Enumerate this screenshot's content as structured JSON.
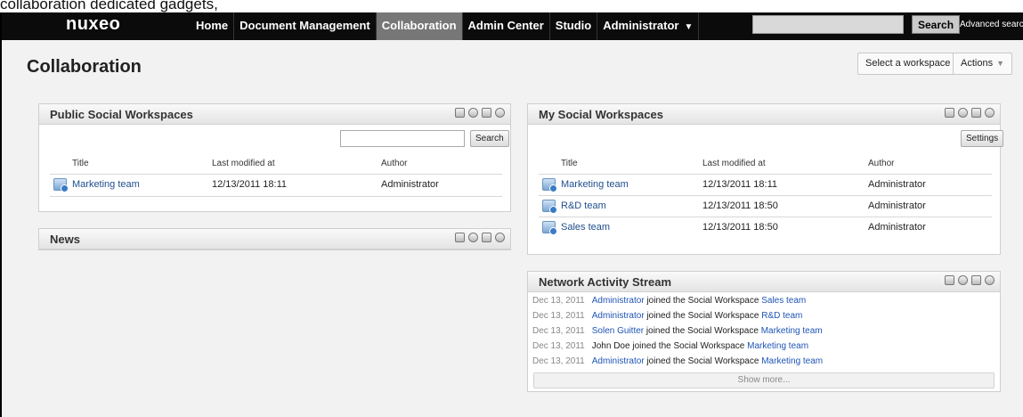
{
  "caption": "collaboration dedicated gadgets,",
  "topbar": {
    "logo": "nuxeo",
    "nav": [
      {
        "label": "Home",
        "active": false
      },
      {
        "label": "Document Management",
        "active": false
      },
      {
        "label": "Collaboration",
        "active": true
      },
      {
        "label": "Admin Center",
        "active": false
      },
      {
        "label": "Studio",
        "active": false
      },
      {
        "label": "Administrator",
        "active": false,
        "dropdown": true
      }
    ],
    "search_value": "",
    "search_label": "Search",
    "advanced_search_label": "Advanced search"
  },
  "page": {
    "title": "Collaboration",
    "select_workspace_label": "Select a workspace",
    "actions_label": "Actions"
  },
  "public_workspaces": {
    "title": "Public Social Workspaces",
    "search_value": "",
    "search_label": "Search",
    "columns": [
      "Title",
      "Last modified at",
      "Author"
    ],
    "rows": [
      {
        "title": "Marketing team",
        "modified": "12/13/2011 18:11",
        "author": "Administrator"
      }
    ]
  },
  "news": {
    "title": "News"
  },
  "my_workspaces": {
    "title": "My Social Workspaces",
    "settings_label": "Settings",
    "columns": [
      "Title",
      "Last modified at",
      "Author"
    ],
    "rows": [
      {
        "title": "Marketing team",
        "modified": "12/13/2011 18:11",
        "author": "Administrator"
      },
      {
        "title": "R&D team",
        "modified": "12/13/2011 18:50",
        "author": "Administrator"
      },
      {
        "title": "Sales team",
        "modified": "12/13/2011 18:50",
        "author": "Administrator"
      }
    ]
  },
  "activity_stream": {
    "title": "Network Activity Stream",
    "joined_text": "joined the Social Workspace",
    "items": [
      {
        "date": "Dec 13, 2011",
        "actor": "Administrator",
        "actor_link": true,
        "workspace": "Sales team"
      },
      {
        "date": "Dec 13, 2011",
        "actor": "Administrator",
        "actor_link": true,
        "workspace": "R&D team"
      },
      {
        "date": "Dec 13, 2011",
        "actor": "Solen Guitter",
        "actor_link": true,
        "workspace": "Marketing team"
      },
      {
        "date": "Dec 13, 2011",
        "actor": "John Doe",
        "actor_link": false,
        "workspace": "Marketing team"
      },
      {
        "date": "Dec 13, 2011",
        "actor": "Administrator",
        "actor_link": true,
        "workspace": "Marketing team"
      }
    ],
    "show_more_label": "Show more..."
  }
}
